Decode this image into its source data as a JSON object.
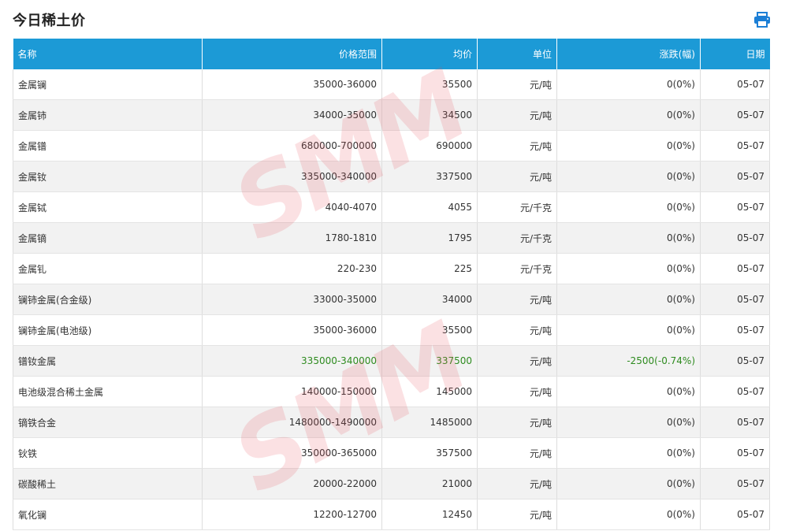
{
  "page": {
    "title": "今日稀土价",
    "print_icon": "print-icon",
    "accent_color": "#1c9ad6",
    "up_color": "#2e8b1f"
  },
  "watermark": "SMM",
  "table": {
    "headers": [
      "名称",
      "价格范围",
      "均价",
      "单位",
      "涨跌(幅)",
      "日期"
    ],
    "rows": [
      {
        "name": "金属镧",
        "range": "35000-36000",
        "avg": "35500",
        "unit": "元/吨",
        "change": "0(0%)",
        "date": "05-07"
      },
      {
        "name": "金属铈",
        "range": "34000-35000",
        "avg": "34500",
        "unit": "元/吨",
        "change": "0(0%)",
        "date": "05-07"
      },
      {
        "name": "金属镨",
        "range": "680000-700000",
        "avg": "690000",
        "unit": "元/吨",
        "change": "0(0%)",
        "date": "05-07"
      },
      {
        "name": "金属钕",
        "range": "335000-340000",
        "avg": "337500",
        "unit": "元/吨",
        "change": "0(0%)",
        "date": "05-07"
      },
      {
        "name": "金属铽",
        "range": "4040-4070",
        "avg": "4055",
        "unit": "元/千克",
        "change": "0(0%)",
        "date": "05-07"
      },
      {
        "name": "金属镝",
        "range": "1780-1810",
        "avg": "1795",
        "unit": "元/千克",
        "change": "0(0%)",
        "date": "05-07"
      },
      {
        "name": "金属钆",
        "range": "220-230",
        "avg": "225",
        "unit": "元/千克",
        "change": "0(0%)",
        "date": "05-07"
      },
      {
        "name": "镧铈金属(合金级)",
        "range": "33000-35000",
        "avg": "34000",
        "unit": "元/吨",
        "change": "0(0%)",
        "date": "05-07"
      },
      {
        "name": "镧铈金属(电池级)",
        "range": "35000-36000",
        "avg": "35500",
        "unit": "元/吨",
        "change": "0(0%)",
        "date": "05-07"
      },
      {
        "name": "镨钕金属",
        "range": "335000-340000",
        "avg": "337500",
        "unit": "元/吨",
        "change": "-2500(-0.74%)",
        "date": "05-07",
        "highlight": true
      },
      {
        "name": "电池级混合稀土金属",
        "range": "140000-150000",
        "avg": "145000",
        "unit": "元/吨",
        "change": "0(0%)",
        "date": "05-07"
      },
      {
        "name": "镝铁合金",
        "range": "1480000-1490000",
        "avg": "1485000",
        "unit": "元/吨",
        "change": "0(0%)",
        "date": "05-07"
      },
      {
        "name": "钬铁",
        "range": "350000-365000",
        "avg": "357500",
        "unit": "元/吨",
        "change": "0(0%)",
        "date": "05-07"
      },
      {
        "name": "碳酸稀土",
        "range": "20000-22000",
        "avg": "21000",
        "unit": "元/吨",
        "change": "0(0%)",
        "date": "05-07"
      },
      {
        "name": "氧化镧",
        "range": "12200-12700",
        "avg": "12450",
        "unit": "元/吨",
        "change": "0(0%)",
        "date": "05-07"
      }
    ]
  }
}
